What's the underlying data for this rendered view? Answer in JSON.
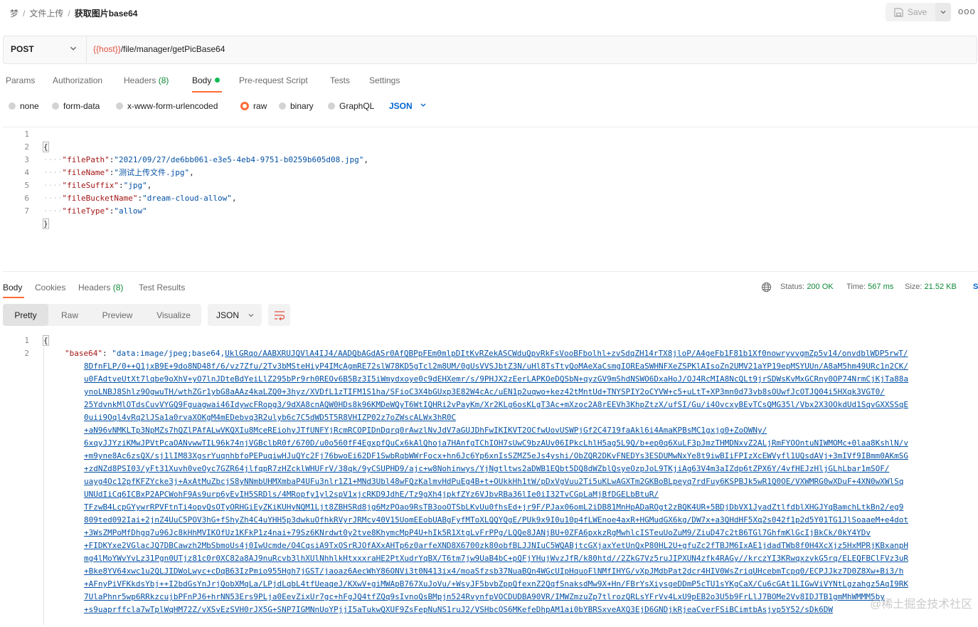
{
  "breadcrumb": {
    "root": "梦",
    "folder": "文件上传",
    "current": "获取图片base64"
  },
  "toolbar": {
    "save_label": "Save",
    "more_label": "ooo"
  },
  "request": {
    "method": "POST",
    "url_var": "{{host}}",
    "url_path": "/file/manager/getPicBase64"
  },
  "req_tabs": {
    "params": "Params",
    "authorization": "Authorization",
    "headers": "Headers",
    "headers_count": "(8)",
    "body": "Body",
    "prerequest": "Pre-request Script",
    "tests": "Tests",
    "settings": "Settings"
  },
  "body_types": {
    "none": "none",
    "form_data": "form-data",
    "urlencoded": "x-www-form-urlencoded",
    "raw": "raw",
    "binary": "binary",
    "graphql": "GraphQL",
    "format": "JSON",
    "selected": "raw"
  },
  "request_body": {
    "line_numbers": [
      "1",
      "2",
      "3",
      "4",
      "5",
      "6",
      "7"
    ],
    "open": "{",
    "close": "}",
    "fields": [
      {
        "key": "\"filePath\"",
        "value": "\"2021/09/27/de6bb061-e3e5-4eb4-9751-b0259b605d08.jpg\"",
        "comma": ","
      },
      {
        "key": "\"fileName\"",
        "value": "\"测试上传文件.jpg\"",
        "comma": ","
      },
      {
        "key": "\"fileSuffix\"",
        "value": "\"jpg\"",
        "comma": ","
      },
      {
        "key": "\"fileBucketName\"",
        "value": "\"dream-cloud-allow\"",
        "comma": ","
      },
      {
        "key": "\"fileType\"",
        "value": "\"allow\"",
        "comma": ""
      }
    ]
  },
  "resp_tabs": {
    "body": "Body",
    "cookies": "Cookies",
    "headers": "Headers",
    "headers_count": "(8)",
    "test_results": "Test Results"
  },
  "response_meta": {
    "status_label": "Status:",
    "status_value": "200 OK",
    "time_label": "Time:",
    "time_value": "567 ms",
    "size_label": "Size:",
    "size_value": "21.52 KB",
    "save_label": "S"
  },
  "view_modes": {
    "pretty": "Pretty",
    "raw": "Raw",
    "preview": "Preview",
    "visualize": "Visualize",
    "format": "JSON"
  },
  "response_body": {
    "line_numbers": [
      "1",
      "2"
    ],
    "open": "{",
    "key": "\"base64\"",
    "value_prefix": "\"data:image/jpeg;base64,",
    "base64_lines": [
      "UklGRqo/AABXRUJQVlA4IJ4/AADQbAGdASr0AfQBPpFEm0mlpDItKvRZekASCWduQpvRkFsVooBFbolhl+zvSdqZH14rTX8jloP/A4geFb1F81b1Xf0nowryvvgmZp5v14/onvdblWDP5rwT/",
      "8DfnFLP/0++Q1jxB9E+9do8ND48f/6/vz7Zfu/2Tv3bMSteHiyP4IMcAgmRE72slW78KD5gTcl2m8UM/0gUsVVSJbtZ3N/uHl8TsTtyQoMAeXaCsmgIOREaSWHNFXeZSPKlAIsoZn2UMV21aYP19epMSYUUn/A8aM5hm49URc1n2CK/",
      "u0FAdtveUtXt7lqbe9oXhV+yO7lnJDteBdYeiLlZ295bPr9rh0REOv6B5Bz3I5iWmydxoye0c9dEHXemr/s/9PHJX2zEerLAPKOeDQSbN+qyzGV9mShdNSWO6DxaHoJ/OJ4RcMIA8NcQLt9jrSDWsKvMxGCRny0OP74NrmCjKjTa88a",
      "ynoLNBJ8Shlz9OgwuTH/wthZGr1ybG8aAAz4kaLZQ0+3hyz/XVDfL1zTIFM1S1ha/SFioC3X4bGUxp3E82W4cAc/uEN1p2uqwo+kez42tMntUd+TNYSPIY2oCYVW+c5+uLtT+XP3mn0d73vb8sOUwfJcOTJQ04i5HXqk3VGT0/",
      "25YdvnkMlOTdsCuvVYGQ9Fguagwai46IdywcFRopg3/9dXA8cnAQW0HDs8k96KMDeWQyT6WtIQHRi2vPayKm/Xr2KLg6osKLgT3Ac+mXzoc2A8rEEVh3KhpZtzX/ufSI/Gu/i4OvcxyBEvTCsQMG35l/Vbx2X3OOkdUd1SqvGXXSSqE",
      "0uii9Oql4vRq2lJSa1a0rvaXOKgM4mEDebvq3R2ulyb6c7C5dWD5T5R8VHIZP02z7oZWscALWx3hR0C",
      "+aN96vNMKLTp3NpMZs7hQZlPAfALwVKQXIu8MceREiohyJTfUNFYjRcmRCOPIDnDqrq0rAwzlNvJdV7aGUJDhFwIKIKVT2OCfwUovUSWPjGf2C4719faAkl6i4AmaKPBsMC1gxjg0+ZoOWNy/",
      "6xqyJJYziKMwJPVtPcaOANvwwTIL96k74njVGBclbR0f/670D/u0o560fF4EgxpfQuCx6kAlQhoja7HAnfgTChIOH7sUwC9bzAUv06IPkcLhlH5ag5L9Q/b+ep0q6XuLF3pJmzTHMDNxvZ2ALjRmFYOOntuNIWMOMc+0laa8KshlN/v",
      "+m9yne8Ac6zsQX/sj1lIM83XgsrYuqnhbfoPEPuqiwHJuQYc2Fj76bwoEi62DF1SwbRqbWWrFocx+hn6Jc6Yp6xnIsSZMZ5eJs4yshi/ObZQR2DKvFNEDYs3ESDUMwNxYe8t9iwBIiFPIzXcEWVyfl1UQsdAVj+3mIVf9IBmm0AKmSG",
      "+zdNZd8PSI03/yFt31Xuvh0veOyc7GZR64jlfqpR7zHZcklWHUFrV/38qk/9yCSUPHD9/ajc+w8Nohinwys/YjNgtltws2aDWB1EQbt5DQ8dWZblQsyeOzpJoL9TKjiAg63V4m3aIZdp6tZPX6Y/4vfHEJzHljGLhLbar1mSOF/",
      "uayg4Oc12pfKFZYcke3j+AxAtMuZbcjS8yNNmbUHMXmbaP4UFu3nlr1Z1+MNd3Ubl48wFQzKalmvHdPuEg4B+t+OUkkHh1tW/pDxVgVuu2Ti5uKLwAGXTm2GKBoBLpeyq7rdFuy6KSPBJk5wR1Q0OE/VXWMRG0wXDuF+4XN0wXWlSq",
      "UNUdIiCq6ICBxP2APCWohF9As9urp6yEvIH5SRDls/4MRopfy1yl2spV1xjcRKD9JdhE/Tz9gXh4jpkfZYz6VJbvRBa36lIe0iI32TvCGpLaMjBfDGELbBtuR/",
      "TFzwB4LcpGYywrRPVFtnTi4opvQsOTyORHGiEyZKiKUHyNQM1Ljt8ZBHSRd8jg6MzPOao9RsTB3ooOTSbLKvUu0fhsEd+jr9F/PJax06omL2iDB81MnHpADaROgt2zBQK4UR+5BDjDbVX1JyadZtlfdblXHGJYqBamchLtkBn2/eg9",
      "809ted092Iai+2jnZ4UuC5POV3hG+fShyZh4C4uYHH5p3dwkuOfhkRVyrJRMcv40V15UomEEobUABgFyfMToXLQQYQgE/PUk9x9I0u10p4fLWEnoe4axR+HGMudGX6kg/DW7x+a3QHdHF5Xq2s042f1p2d5Y01TG1JlSoaaeM+e4dot",
      "+3WsZMPoMfDhgq7u96Jc8kHhMVIKOfUz1KFkP1z4nai+79Sz6KNrdwt0y2tve8KhymcMpP4U+hIk5R1XtgLvFrPPg/LQQe8JANjBU+0ZFA6pxkzRgMwhlcISTeuUoZuM9/ZiuD47c2tB6TGl7GhfmKlGcIjBkCk/0kY4YDv",
      "+FIDKYxe2VGlacJQ7DBCawzh2MbSbmoUs4j0IwUcmde/O4CqsiA9TxOSrRJOfAXxAHTp6z0arfeXND8X6700zk80obfBLJJNIuC5WQABjtcGXjaxYetUnQxP80HL2U+gfuZc2fTBJM6IxAE1jdadTWb8f0H4XcXjz5HxMPRjKBxanpH",
      "mg4lMoYWvYvLz31Pgn0UTjz81c0r0XC82a8AJ9nuRcvb3lhXUlNhhlkHtxxxraHE2PtXudrYqBX/T6tm7jw9UaB4bC+pQFjYHujWvzJfR/k80htd//2ZkG7Vz5ruJIPXUN4zfk4RAGy//krczYI3KRwqxzvkG5rq/ELEQFBClFVz3uR",
      "+Bke8YV64xwc1u2QLJIDWoLwyc+cDqB63IzPmio955Hgh7jGST/jaoaz6AecWhY86ONVi3t0N413ix4/moaSfzsb37NuaBQn4WGcUIpHquoFlNMfIHYG/vXpJMdbPat2dcr4HIV0WsZriqUHcebmTcpq0/ECPJJkz7D0Z8Xw+Bi3/h",
      "+AFnyPiVFKkdsYbj++I2bdGsYnJrjQobXMqLa/LPjdLqbL4tfUeaqeJ/KXwV+giMWApB767XuJoVu/+WsyJF5bvbZppQfexnZ2QqfSnaksdMw9X+Hn/FBrYsXiysgeDDmP5cTU1sYKgCaX/Cu6cGAt1LIGwViVYNtLgzahgz5AqI9RK",
      "7UlaPhnr5wp6RRkzcujbPFnPJ6+hrNN53Ers9PLja0EevZixUr7gc+hFgJQ4tfZQq9sIvnoQsBMpjn524RvynfpVOCDUDBA90VR/IMWZmzuZp7tlrozQRLsYFrVv4LxU9pEB2o3U5b9FrLlJ7BOMe2Vv8IDJTB1gmMhWMMM5by",
      "+s9uaprffcla7wTplWqHM72Z/vXSvEzSVH0rJX5G+SNP7IGMNnUoYPjjI5aTukwQXUF9ZsFepNuNS1ruJ2/VSHbcOS6MKefeDhpAM1ai0bYBRSxveAXQ3EjD6GNDjkRjeaCverFSiBCimtbAsjvp5Y52/sDk6DW"
    ]
  },
  "watermark": "@稀土掘金技术社区"
}
